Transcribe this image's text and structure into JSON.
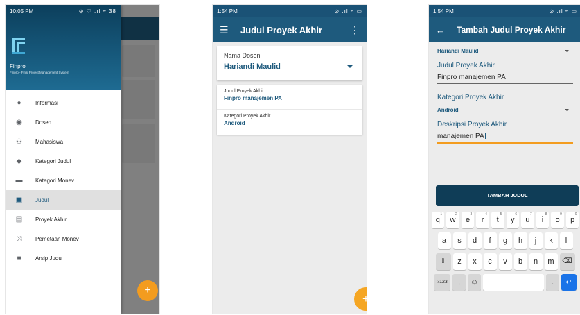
{
  "phone1": {
    "status": {
      "time": "10:05 PM",
      "icons_right": "⊘ ♡ .ıl ≈ 38"
    },
    "drawer": {
      "app_name": "Finpro",
      "app_subtitle": "Finpro - Final Project Management System",
      "logo_text": "FinPRO",
      "items": [
        {
          "label": "Informasi",
          "icon": "info-icon"
        },
        {
          "label": "Dosen",
          "icon": "account-icon"
        },
        {
          "label": "Mahasiswa",
          "icon": "people-icon"
        },
        {
          "label": "Kategori Judul",
          "icon": "tag-icon"
        },
        {
          "label": "Kategori Monev",
          "icon": "label-icon"
        },
        {
          "label": "Judul",
          "icon": "assignment-icon",
          "active": true
        },
        {
          "label": "Proyek Akhir",
          "icon": "assignment-ind-icon"
        },
        {
          "label": "Pemetaan Monev",
          "icon": "shuffle-icon"
        },
        {
          "label": "Arsip Judul",
          "icon": "folder-icon"
        }
      ]
    },
    "fab": "+"
  },
  "phone2": {
    "status": {
      "time": "1:54 PM",
      "icons_right": "⊘ .ıl ≈ ▭"
    },
    "title": "Judul Proyek Akhir",
    "dosen_label": "Nama Dosen",
    "dosen_value": "Hariandi Maulid",
    "judul_label": "Judul Proyek Akhir",
    "judul_value": "Finpro manajemen PA",
    "kategori_label": "Kategori Proyek Akhir",
    "kategori_value": "Android",
    "fab": "+"
  },
  "phone3": {
    "status": {
      "time": "1:54 PM",
      "icons_right": "⊘ .ıl ≈ ▭"
    },
    "title": "Tambah Judul Proyek Akhir",
    "dosen_value": "Hariandi Maulid",
    "judul_label": "Judul Proyek Akhir",
    "judul_value": "Finpro manajemen PA",
    "kategori_label": "Kategori Proyek Akhir",
    "kategori_value": "Android",
    "deskripsi_label": "Deskripsi Proyek Akhir",
    "deskripsi_value_a": "manajemen",
    "deskripsi_value_b": "PA",
    "submit_label": "TAMBAH JUDUL",
    "keyboard": {
      "row1": [
        [
          "q",
          "1"
        ],
        [
          "w",
          "2"
        ],
        [
          "e",
          "3"
        ],
        [
          "r",
          "4"
        ],
        [
          "t",
          "5"
        ],
        [
          "y",
          "6"
        ],
        [
          "u",
          "7"
        ],
        [
          "i",
          "8"
        ],
        [
          "o",
          "9"
        ],
        [
          "p",
          "0"
        ]
      ],
      "row2": [
        "a",
        "s",
        "d",
        "f",
        "g",
        "h",
        "j",
        "k",
        "l"
      ],
      "row3": [
        "z",
        "x",
        "c",
        "v",
        "b",
        "n",
        "m"
      ],
      "sym_label": "?123",
      "comma": ",",
      "period": "."
    }
  }
}
